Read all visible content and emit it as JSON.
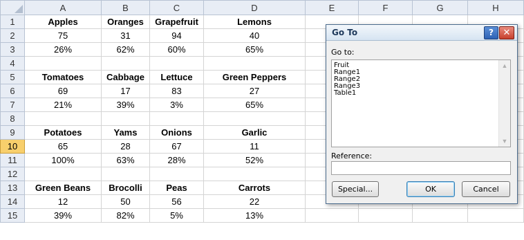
{
  "columns": [
    "A",
    "B",
    "C",
    "D",
    "E",
    "F",
    "G",
    "H"
  ],
  "active_row": "10",
  "rows": [
    {
      "num": "1",
      "cells": [
        "Apples",
        "Oranges",
        "Grapefruit",
        "Lemons",
        "",
        "",
        "",
        ""
      ],
      "bold": true
    },
    {
      "num": "2",
      "cells": [
        "75",
        "31",
        "94",
        "40",
        "",
        "",
        "",
        ""
      ],
      "bold": false
    },
    {
      "num": "3",
      "cells": [
        "26%",
        "62%",
        "60%",
        "65%",
        "",
        "",
        "",
        ""
      ],
      "bold": false
    },
    {
      "num": "4",
      "cells": [
        "",
        "",
        "",
        "",
        "",
        "",
        "",
        ""
      ],
      "bold": false
    },
    {
      "num": "5",
      "cells": [
        "Tomatoes",
        "Cabbage",
        "Lettuce",
        "Green Peppers",
        "",
        "",
        "",
        ""
      ],
      "bold": true
    },
    {
      "num": "6",
      "cells": [
        "69",
        "17",
        "83",
        "27",
        "",
        "",
        "",
        ""
      ],
      "bold": false
    },
    {
      "num": "7",
      "cells": [
        "21%",
        "39%",
        "3%",
        "65%",
        "",
        "",
        "",
        ""
      ],
      "bold": false
    },
    {
      "num": "8",
      "cells": [
        "",
        "",
        "",
        "",
        "",
        "",
        "",
        ""
      ],
      "bold": false
    },
    {
      "num": "9",
      "cells": [
        "Potatoes",
        "Yams",
        "Onions",
        "Garlic",
        "",
        "",
        "",
        ""
      ],
      "bold": true
    },
    {
      "num": "10",
      "cells": [
        "65",
        "28",
        "67",
        "11",
        "",
        "",
        "",
        ""
      ],
      "bold": false
    },
    {
      "num": "11",
      "cells": [
        "100%",
        "63%",
        "28%",
        "52%",
        "",
        "",
        "",
        ""
      ],
      "bold": false
    },
    {
      "num": "12",
      "cells": [
        "",
        "",
        "",
        "",
        "",
        "",
        "",
        ""
      ],
      "bold": false
    },
    {
      "num": "13",
      "cells": [
        "Green Beans",
        "Brocolli",
        "Peas",
        "Carrots",
        "",
        "",
        "",
        ""
      ],
      "bold": true
    },
    {
      "num": "14",
      "cells": [
        "12",
        "50",
        "56",
        "22",
        "",
        "",
        "",
        ""
      ],
      "bold": false
    },
    {
      "num": "15",
      "cells": [
        "39%",
        "82%",
        "5%",
        "13%",
        "",
        "",
        "",
        ""
      ],
      "bold": false
    }
  ],
  "dialog": {
    "title": "Go To",
    "help_glyph": "?",
    "close_glyph": "✕",
    "goto_label": "Go to:",
    "items": [
      "Fruit",
      "Range1",
      "Range2",
      "Range3",
      "Table1"
    ],
    "reference_label": "Reference:",
    "reference_value": "",
    "special_label": "Special...",
    "ok_label": "OK",
    "cancel_label": "Cancel"
  }
}
